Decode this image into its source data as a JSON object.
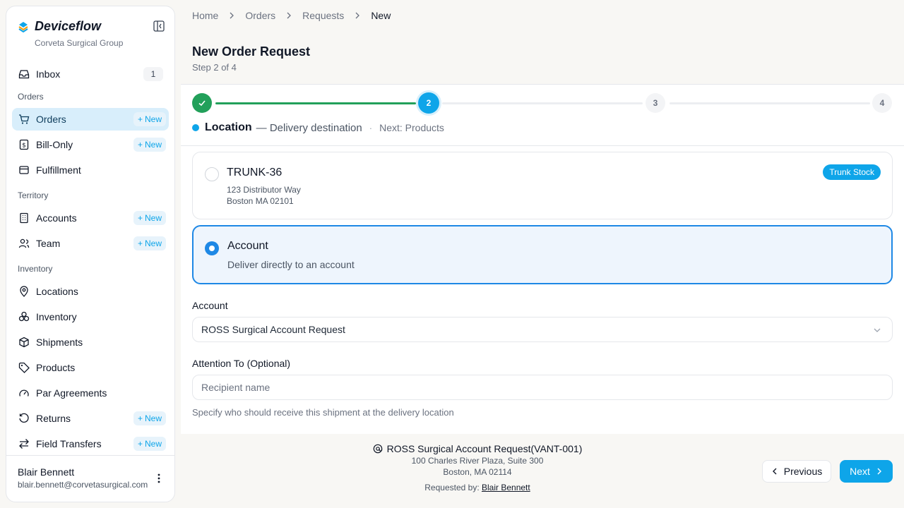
{
  "app": {
    "brand": "Deviceflow",
    "org": "Corveta Surgical Group"
  },
  "sidebar": {
    "inbox": {
      "label": "Inbox",
      "count": "1"
    },
    "sections": {
      "orders": "Orders",
      "territory": "Territory",
      "inventory": "Inventory"
    },
    "new_label": "New",
    "items": {
      "orders": "Orders",
      "bill_only": "Bill-Only",
      "fulfillment": "Fulfillment",
      "accounts": "Accounts",
      "team": "Team",
      "locations": "Locations",
      "inventory": "Inventory",
      "shipments": "Shipments",
      "products": "Products",
      "par_agreements": "Par Agreements",
      "returns": "Returns",
      "field_transfers": "Field Transfers"
    },
    "user": {
      "name": "Blair Bennett",
      "email": "blair.bennett@corvetasurgical.com"
    }
  },
  "breadcrumb": [
    "Home",
    "Orders",
    "Requests",
    "New"
  ],
  "page": {
    "title": "New Order Request",
    "subtitle": "Step 2 of 4"
  },
  "stepper": {
    "steps": [
      "1",
      "2",
      "3",
      "4"
    ],
    "current": 2,
    "caption_title": "Location",
    "caption_desc": "— Delivery destination",
    "caption_sep": "·",
    "caption_next": "Next: Products",
    "colors": {
      "done": "#22a05a",
      "current": "#0ea5e9",
      "pending": "#f3f4f6"
    }
  },
  "options": {
    "trunk": {
      "title": "TRUNK-36",
      "line1": "123 Distributor Way",
      "line2": "Boston MA 02101",
      "badge": "Trunk Stock",
      "selected": false
    },
    "account": {
      "title": "Account",
      "desc": "Deliver directly to an account",
      "selected": true
    }
  },
  "form": {
    "account_label": "Account",
    "account_value": "ROSS Surgical Account Request",
    "attention_label": "Attention To (Optional)",
    "attention_placeholder": "Recipient name",
    "attention_helper": "Specify who should receive this shipment at the delivery location"
  },
  "summary": {
    "title": "ROSS Surgical Account Request(VANT-001)",
    "line1": "100 Charles River Plaza, Suite 300",
    "line2": "Boston, MA 02114",
    "requested_by_label": "Requested by:",
    "requested_by": "Blair Bennett"
  },
  "actions": {
    "previous": "Previous",
    "next": "Next"
  },
  "icons": {
    "brand": "deviceflow-logo",
    "collapse": "sidebar-collapse-icon",
    "inbox": "inbox-icon",
    "orders": "cart-icon",
    "bill_only": "receipt-icon",
    "fulfillment": "box-icon",
    "accounts": "building-icon",
    "team": "users-icon",
    "locations": "map-pin-icon",
    "inventory": "boxes-icon",
    "shipments": "package-icon",
    "products": "tag-icon",
    "par": "gauge-icon",
    "returns": "rotate-icon",
    "field_transfers": "transfer-icon",
    "menu": "more-vertical-icon"
  }
}
